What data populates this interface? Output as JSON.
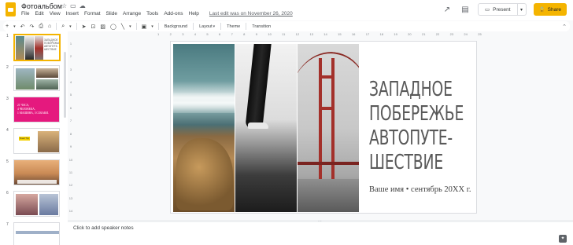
{
  "app": {
    "doc_title": "Фотоальбом",
    "title_icons": [
      "star-icon",
      "folder-icon",
      "cloud-icon"
    ],
    "menu": [
      "File",
      "Edit",
      "View",
      "Insert",
      "Format",
      "Slide",
      "Arrange",
      "Tools",
      "Add-ons",
      "Help"
    ],
    "last_edit": "Last edit was on November 26, 2020",
    "present_label": "Present",
    "share_label": "Share",
    "share_icon": "🔒",
    "brand_color": "#f4b400"
  },
  "toolbar": {
    "background_label": "Background",
    "layout_label": "Layout",
    "theme_label": "Theme",
    "transition_label": "Transition"
  },
  "ruler": {
    "h_ticks": [
      "1",
      "2",
      "3",
      "4",
      "5",
      "6",
      "7",
      "8",
      "9",
      "10",
      "11",
      "12",
      "13",
      "14",
      "15",
      "16",
      "17",
      "18",
      "19",
      "20",
      "21",
      "22",
      "23",
      "24",
      "25"
    ],
    "v_ticks": [
      "1",
      "2",
      "3",
      "4",
      "5",
      "6",
      "7",
      "8",
      "9",
      "10",
      "11",
      "12",
      "13",
      "14"
    ]
  },
  "filmstrip": {
    "slides": [
      {
        "number": "1",
        "selected": true
      },
      {
        "number": "2",
        "selected": false
      },
      {
        "number": "3",
        "selected": false
      },
      {
        "number": "4",
        "selected": false
      },
      {
        "number": "5",
        "selected": false
      },
      {
        "number": "6",
        "selected": false
      },
      {
        "number": "7",
        "selected": false
      }
    ],
    "thumb1_title": "ЗАПАДНОЕ ПОБЕРЕЖЬЕ АВТОПУТЕ-ШЕСТВИЕ",
    "thumb3_lines": [
      "21 ЧАСА,",
      "4 ЧЕЛОВЕКА,",
      "1 МАШИНА, 3 СОБАКИ."
    ],
    "thumb4_label": "Road Trip"
  },
  "slide": {
    "title": "ЗАПАДНОЕ ПОБЕРЕЖЬЕ АВТОПУТЕ-ШЕСТВИЕ",
    "subtitle": "Ваше имя • сентябрь 20XX г."
  },
  "notes": {
    "placeholder": "Click to add speaker notes"
  }
}
